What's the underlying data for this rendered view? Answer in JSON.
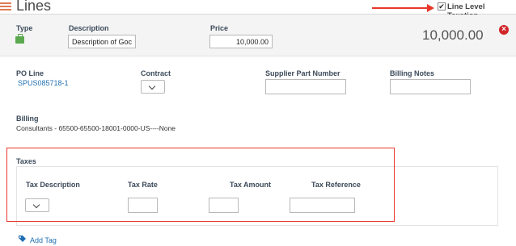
{
  "header": {
    "title": "Lines",
    "line_level_taxation_label": "Line Level Taxation"
  },
  "row": {
    "type_label": "Type",
    "description_label": "Description",
    "description_value": "Description of Goc",
    "price_label": "Price",
    "price_value": "10,000.00",
    "total": "10,000.00"
  },
  "details": {
    "po_line_label": "PO Line",
    "po_line_value": "SPUS085718-1",
    "contract_label": "Contract",
    "supplier_part_label": "Supplier Part Number",
    "billing_notes_label": "Billing Notes",
    "billing_label": "Billing",
    "billing_value": "Consultants - 65500-65500-18001-0000-US----None"
  },
  "taxes": {
    "section_label": "Taxes",
    "columns": [
      "Tax Description",
      "Tax Rate",
      "Tax Amount",
      "Tax Reference"
    ]
  },
  "footer": {
    "add_tag_label": "Add Tag"
  },
  "colors": {
    "accent_red": "#e8372a",
    "link_blue": "#1f6fb2",
    "error_red": "#d2262b"
  },
  "icons": [
    "menu-icon",
    "goods-type-icon",
    "remove-line-icon",
    "chevron-down-icon",
    "add-tag-icon"
  ]
}
